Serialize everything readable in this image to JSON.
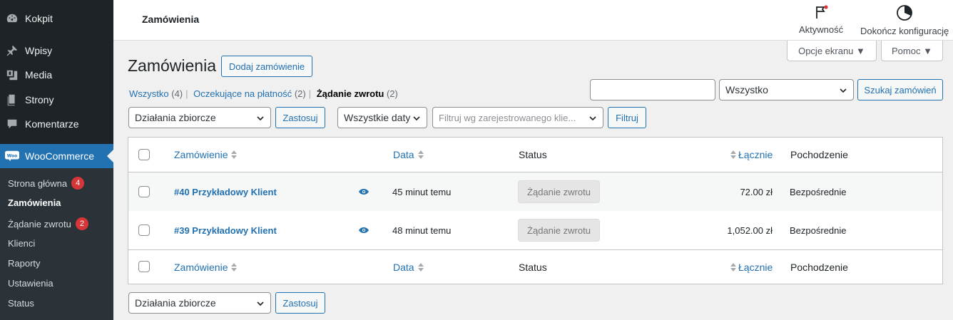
{
  "sidebar": {
    "items": [
      {
        "label": "Kokpit",
        "icon": "dashboard-icon"
      },
      {
        "label": "Wpisy",
        "icon": "pin-icon"
      },
      {
        "label": "Media",
        "icon": "media-icon"
      },
      {
        "label": "Strony",
        "icon": "pages-icon"
      },
      {
        "label": "Komentarze",
        "icon": "comments-icon"
      },
      {
        "label": "WooCommerce",
        "icon": "woo-icon"
      }
    ],
    "woo_logo_text": "Woo",
    "submenu": [
      {
        "label": "Strona główna",
        "badge": "4"
      },
      {
        "label": "Zamówienia",
        "badge": ""
      },
      {
        "label": "Żądanie zwrotu",
        "badge": "2"
      },
      {
        "label": "Klienci",
        "badge": ""
      },
      {
        "label": "Raporty",
        "badge": ""
      },
      {
        "label": "Ustawienia",
        "badge": ""
      },
      {
        "label": "Status",
        "badge": ""
      }
    ]
  },
  "topbar": {
    "title": "Zamówienia",
    "activity_label": "Aktywność",
    "setup_label": "Dokończ konfigurację",
    "screen_options": "Opcje ekranu ▼",
    "help": "Pomoc ▼"
  },
  "page": {
    "heading": "Zamówienia",
    "add_button": "Dodaj zamówienie",
    "views": [
      {
        "label": "Wszystko",
        "count": "(4)"
      },
      {
        "label": "Oczekujące na płatność",
        "count": "(2)"
      },
      {
        "label": "Żądanie zwrotu",
        "count": "(2)"
      }
    ],
    "search_value": "",
    "search_scope": "Wszystko",
    "search_button": "Szukaj zamówień",
    "bulk_actions": "Działania zbiorcze",
    "apply": "Zastosuj",
    "all_dates": "Wszystkie daty",
    "customer_filter_placeholder": "Filtruj wg zarejestrowanego klie...",
    "filter_button": "Filtruj"
  },
  "table": {
    "columns": {
      "order": "Zamówienie",
      "date": "Data",
      "status": "Status",
      "total": "Łącznie",
      "origin": "Pochodzenie"
    },
    "rows": [
      {
        "order": "#40 Przykładowy Klient",
        "date": "45 minut temu",
        "status": "Żądanie zwrotu",
        "total": "72.00 zł",
        "origin": "Bezpośrednie"
      },
      {
        "order": "#39 Przykładowy Klient",
        "date": "48 minut temu",
        "status": "Żądanie zwrotu",
        "total": "1,052.00 zł",
        "origin": "Bezpośrednie"
      }
    ]
  },
  "colors": {
    "sidebar_bg": "#1d2327",
    "accent": "#2271b1",
    "badge": "#d63638"
  }
}
